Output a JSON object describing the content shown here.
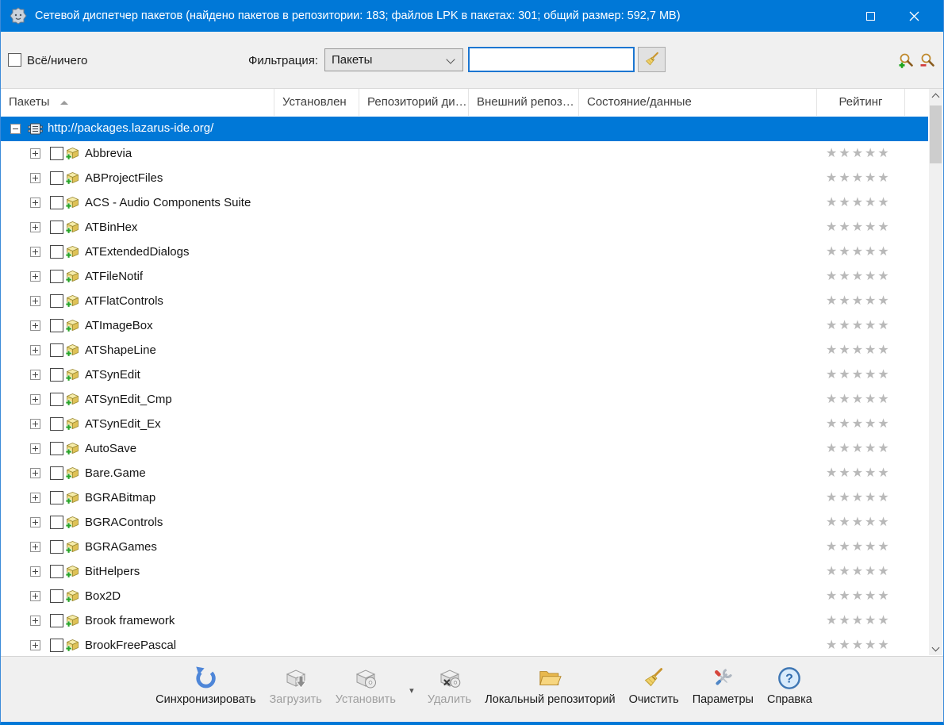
{
  "window": {
    "title": "Сетевой диспетчер пакетов (найдено пакетов в репозитории: 183; файлов LPK в пакетах: 301; общий размер: 592,7 MB)"
  },
  "filter_bar": {
    "select_all_label": "Всё/ничего",
    "select_all_checked": false,
    "filter_label": "Фильтрация:",
    "filter_selected_option": "Пакеты",
    "search_value": ""
  },
  "columns": {
    "packages": "Пакеты",
    "installed": "Установлен",
    "repository": "Репозиторий ди…",
    "external_repository": "Внешний репоз…",
    "state": "Состояние/данные",
    "rating": "Рейтинг"
  },
  "tree": {
    "repository_url": "http://packages.lazarus-ide.org/",
    "repository_expanded": true,
    "repository_selected": true,
    "packages": [
      {
        "name": "Abbrevia",
        "checked": false,
        "rating": 0
      },
      {
        "name": "ABProjectFiles",
        "checked": false,
        "rating": 0
      },
      {
        "name": "ACS - Audio Components Suite",
        "checked": false,
        "rating": 0
      },
      {
        "name": "ATBinHex",
        "checked": false,
        "rating": 0
      },
      {
        "name": "ATExtendedDialogs",
        "checked": false,
        "rating": 0
      },
      {
        "name": "ATFileNotif",
        "checked": false,
        "rating": 0
      },
      {
        "name": "ATFlatControls",
        "checked": false,
        "rating": 0
      },
      {
        "name": "ATImageBox",
        "checked": false,
        "rating": 0
      },
      {
        "name": "ATShapeLine",
        "checked": false,
        "rating": 0
      },
      {
        "name": "ATSynEdit",
        "checked": false,
        "rating": 0
      },
      {
        "name": "ATSynEdit_Cmp",
        "checked": false,
        "rating": 0
      },
      {
        "name": "ATSynEdit_Ex",
        "checked": false,
        "rating": 0
      },
      {
        "name": "AutoSave",
        "checked": false,
        "rating": 0
      },
      {
        "name": "Bare.Game",
        "checked": false,
        "rating": 0
      },
      {
        "name": "BGRABitmap",
        "checked": false,
        "rating": 0
      },
      {
        "name": "BGRAControls",
        "checked": false,
        "rating": 0
      },
      {
        "name": "BGRAGames",
        "checked": false,
        "rating": 0
      },
      {
        "name": "BitHelpers",
        "checked": false,
        "rating": 0
      },
      {
        "name": "Box2D",
        "checked": false,
        "rating": 0
      },
      {
        "name": "Brook framework",
        "checked": false,
        "rating": 0
      },
      {
        "name": "BrookFreePascal",
        "checked": false,
        "rating": 0
      }
    ]
  },
  "actions": {
    "sync": "Синхронизировать",
    "download": "Загрузить",
    "install": "Установить",
    "uninstall": "Удалить",
    "local_repository": "Локальный репозиторий",
    "cleanup": "Очистить",
    "options": "Параметры",
    "help": "Справка"
  },
  "ui": {
    "stars": "★★★★★",
    "more_arrow": "▾"
  },
  "colors": {
    "titlebar": "#0078d7",
    "selection": "#0078d7",
    "toolbar_bg": "#f0f0f0",
    "star_gray": "#b9b9b9",
    "disabled_text": "#9e9e9e"
  }
}
